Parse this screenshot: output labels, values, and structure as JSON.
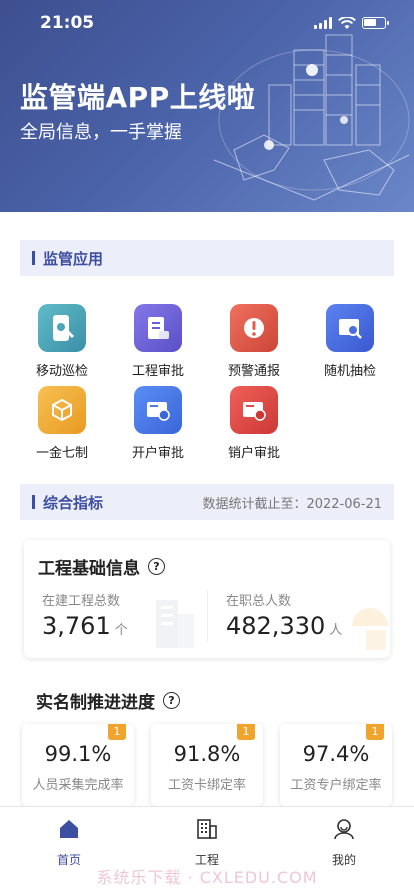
{
  "status_bar": {
    "time": "21:05"
  },
  "banner": {
    "title": "监管端APP上线啦",
    "subtitle": "全局信息，一手掌握"
  },
  "apps_section": {
    "title": "监管应用"
  },
  "apps": [
    {
      "label": "移动巡检",
      "icon": "mobile-inspection-icon",
      "color": "#4aa6b8"
    },
    {
      "label": "工程审批",
      "icon": "project-approval-icon",
      "color": "#6a5fd8"
    },
    {
      "label": "预警通报",
      "icon": "warning-icon",
      "color": "#e05a4e"
    },
    {
      "label": "随机抽检",
      "icon": "random-check-icon",
      "color": "#4a6ee0"
    },
    {
      "label": "一金七制",
      "icon": "cube-icon",
      "color": "#f0a830"
    },
    {
      "label": "开户审批",
      "icon": "open-account-icon",
      "color": "#4a7ee8"
    },
    {
      "label": "销户审批",
      "icon": "close-account-icon",
      "color": "#e04a48"
    }
  ],
  "metrics_section": {
    "title": "综合指标",
    "meta": "数据统计截止至：2022-06-21"
  },
  "project_info": {
    "title": "工程基础信息",
    "projects_label": "在建工程总数",
    "projects_value": "3,761",
    "projects_unit": "个",
    "workers_label": "在职总人数",
    "workers_value": "482,330",
    "workers_unit": "人"
  },
  "realname": {
    "title": "实名制推进进度",
    "cards": [
      {
        "badge": "1",
        "value": "99.1%",
        "label": "人员采集完成率"
      },
      {
        "badge": "1",
        "value": "91.8%",
        "label": "工资卡绑定率"
      },
      {
        "badge": "1",
        "value": "97.4%",
        "label": "工资专户绑定率"
      }
    ]
  },
  "tabs": [
    {
      "label": "首页",
      "icon": "home-icon",
      "active": true
    },
    {
      "label": "工程",
      "icon": "building-icon",
      "active": false
    },
    {
      "label": "我的",
      "icon": "user-icon",
      "active": false
    }
  ],
  "watermark": "系统乐下载 · CXLEDU.COM",
  "colors": {
    "accent": "#3d4fa0",
    "badge": "#f0a42c"
  }
}
